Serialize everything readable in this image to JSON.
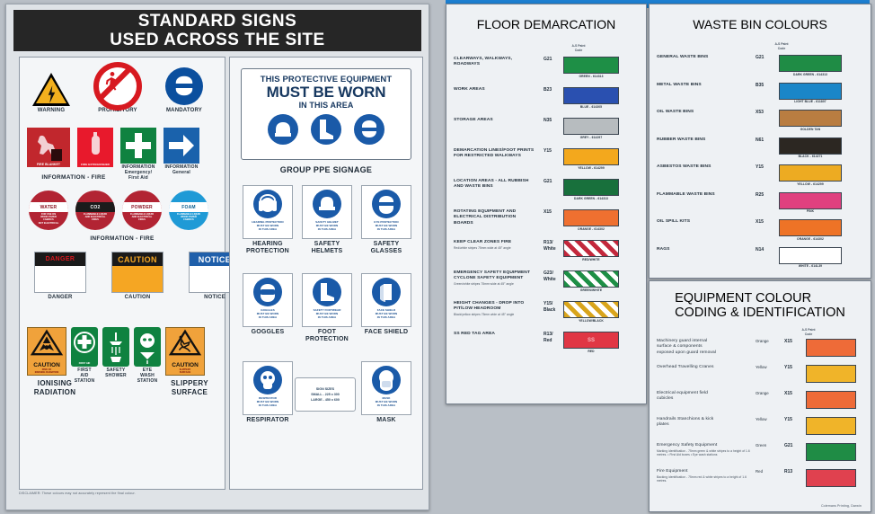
{
  "left_poster": {
    "title": "STANDARD SIGNS\nUSED ACROSS THE SITE",
    "title_line1": "STANDARD SIGNS",
    "title_line2": "USED ACROSS THE SITE",
    "disclaimer": "DISCLAIMER: These colours may not accurately represent the final colour.",
    "sign_types": [
      {
        "label": "WARNING",
        "icon": "warning-triangle-icon",
        "color": "#f2b01e"
      },
      {
        "label": "PROHIBITORY",
        "icon": "prohibition-circle-icon",
        "color": "#d71920"
      },
      {
        "label": "MANDATORY",
        "icon": "mandatory-circle-icon",
        "color": "#0b4f9e"
      }
    ],
    "information_fire": {
      "group_label": "INFORMATION - FIRE",
      "items": [
        {
          "label": "FIRE BLANKET",
          "caption": "",
          "color": "#c1272d",
          "icon": "fire-blanket-icon"
        },
        {
          "label": "FIRE EXTINGUISHER",
          "caption": "",
          "color": "#e8192c",
          "icon": "fire-extinguisher-icon"
        },
        {
          "label": "",
          "caption": "INFORMATION\nEmergency/\nFirst Aid",
          "color": "#0f8240",
          "icon": "first-aid-cross-icon"
        },
        {
          "label": "",
          "caption": "INFORMATION\nGeneral",
          "color": "#1a62ac",
          "icon": "arrow-right-icon"
        }
      ]
    },
    "extinguisher_types": {
      "group_label": "INFORMATION - FIRE",
      "items": [
        {
          "label": "WATER",
          "color": "#b22433",
          "text_color": "#8c1322",
          "sub": "FOR USE ON\nWOOD PAPER\nFABRICS\nNOT ELECTRICAL"
        },
        {
          "label": "CO2",
          "color": "#b22433",
          "band_color": "#1b1b1b",
          "band_text_color": "#ffffff",
          "sub": "FLAMMABLE LIQUID\nAND ELECTRICAL\nFIRES"
        },
        {
          "label": "POWDER",
          "color": "#b22433",
          "text_color": "#8c1322",
          "sub": "FLAMMABLE LIQUID\nAND ELECTRICAL\nFIRES"
        },
        {
          "label": "FOAM",
          "color": "#1f9ad6",
          "text_color": "#0a5f91",
          "sub": "FLAMMABLE LIQUID\nWOOD PAPER\nFABRICS"
        }
      ]
    },
    "header_signs": [
      {
        "label": "DANGER",
        "word": "DANGER",
        "header_color": "#1a1a1a",
        "word_color": "#d71920",
        "body_color": "#ffffff"
      },
      {
        "label": "CAUTION",
        "word": "CAUTION",
        "header_color": "#1a1a1a",
        "word_color": "#f5a623",
        "body_color": "#f5a623"
      },
      {
        "label": "NOTICE",
        "word": "NOTICE",
        "header_color": "#1f5faa",
        "word_color": "#ffffff",
        "body_color": "#ffffff"
      }
    ],
    "bottom_signs": [
      {
        "caption": "IONISING\nRADIATION",
        "sign_word": "CAUTION",
        "sign_sub": "RISK OF\nIONISING RADIATION",
        "color": "#f0a23b",
        "icon": "radiation-trefoil-icon"
      },
      {
        "caption": "FIRST\nAID\nSTATION",
        "sign_word": "FIRST AID",
        "color": "#0f8240",
        "icon": "first-aid-cross-icon"
      },
      {
        "caption": "SAFETY\nSHOWER",
        "sign_word": "",
        "color": "#0f8240",
        "icon": "safety-shower-icon"
      },
      {
        "caption": "EYE\nWASH\nSTATION",
        "sign_word": "",
        "color": "#0f8240",
        "icon": "eye-wash-icon"
      },
      {
        "caption": "SLIPPERY\nSURFACE",
        "sign_word": "CAUTION",
        "sign_sub": "SLIPPERY\nSURFACE",
        "color": "#f0a23b",
        "icon": "slip-hazard-icon"
      }
    ],
    "group_ppe": {
      "line1": "THIS PROTECTIVE EQUIPMENT",
      "line2": "MUST BE WORN",
      "line3": "IN THIS AREA",
      "caption": "GROUP PPE SIGNAGE",
      "icons": [
        "hard-hat-icon",
        "safety-boot-icon",
        "safety-glasses-icon"
      ]
    },
    "ppe_signs": [
      {
        "caption": "HEARING\nPROTECTION",
        "sign_text": "HEARING PROTECTION\nMUST BE WORN\nIN THIS AREA",
        "icon": "ear-muffs-icon"
      },
      {
        "caption": "SAFETY\nHELMETS",
        "sign_text": "SAFETY HELMET\nMUST BE WORN\nIN THIS AREA",
        "icon": "hard-hat-icon"
      },
      {
        "caption": "SAFETY\nGLASSES",
        "sign_text": "EYE PROTECTION\nMUST BE WORN\nIN THIS AREA",
        "icon": "safety-glasses-icon"
      },
      {
        "caption": "GOGGLES",
        "sign_text": "GOGGLES\nMUST BE WORN\nIN THIS AREA",
        "icon": "goggles-icon"
      },
      {
        "caption": "FOOT\nPROTECTION",
        "sign_text": "SAFETY FOOTWEAR\nMUST BE WORN\nIN THIS AREA",
        "icon": "safety-boot-icon"
      },
      {
        "caption": "FACE SHIELD",
        "sign_text": "FACE SHIELD\nMUST BE WORN\nIN THIS AREA",
        "icon": "face-shield-icon"
      },
      {
        "caption": "RESPIRATOR",
        "sign_text": "RESPIRATOR\nMUST BE WORN\nIN THIS AREA",
        "icon": "respirator-icon"
      },
      {
        "caption": "MASK",
        "sign_text": "MASK\nMUST BE WORN\nIN THIS AREA",
        "icon": "dust-mask-icon"
      }
    ],
    "sizes_note": {
      "line1": "SIGN SIZES",
      "line2": "SMALL - 225 x 300",
      "line3": "LARGE - 450 x 600"
    }
  },
  "floor_demarcation": {
    "title": "FLOOR DEMARCATION",
    "code_header": "A-S Paint\nCode",
    "rows": [
      {
        "name": "CLEARWAYS, WALKWAYS,\nROADWAYS",
        "sub": "",
        "code": "G21",
        "swatch": "#1e8f46",
        "swatch_label": "GREEN - 614313",
        "pattern": "solid"
      },
      {
        "name": "WORK AREAS",
        "sub": "",
        "code": "B23",
        "swatch": "#2a50b0",
        "swatch_label": "BLUE - 614305",
        "pattern": "solid"
      },
      {
        "name": "STORAGE AREAS",
        "sub": "",
        "code": "N35",
        "swatch": "#b7bcbf",
        "swatch_label": "GREY - 614297",
        "pattern": "solid"
      },
      {
        "name": "DEMARCATION LINES/FOOT PRINTS\nFOR RESTRICTED WALKWAYS",
        "sub": "",
        "code": "Y15",
        "swatch": "#f3a81d",
        "swatch_label": "YELLOW - 614299",
        "pattern": "solid"
      },
      {
        "name": "LOCATION AREAS - ALL RUBBISH\nAND WASTE BINS",
        "sub": "",
        "code": "G21",
        "swatch": "#18703c",
        "swatch_label": "DARK GREEN - 614313",
        "pattern": "solid"
      },
      {
        "name": "ROTATING EQUIPMENT AND\nELECTRICAL DISTRIBUTION\nBOARDS",
        "sub": "",
        "code": "X15",
        "swatch": "#ef7030",
        "swatch_label": "ORANGE - 614302",
        "pattern": "solid"
      },
      {
        "name": "KEEP CLEAR ZONES FIRE",
        "sub": "Red/white stripes 75mm wide at 45° angle",
        "code": "R13/\nWhite",
        "swatch": "#c3283c",
        "swatch_label": "RED/WHITE",
        "pattern": "stripe"
      },
      {
        "name": "EMERGENCY SAFETY EQUIPMENT\nCYCLONE SAFETY EQUIPMENT",
        "sub": "Green/white stripes 75mm wide at 45° angle",
        "code": "G23/\nWhite",
        "swatch": "#1e8f46",
        "swatch_label": "GREEN/WHITE",
        "pattern": "stripe"
      },
      {
        "name": "HEIGHT CHANGES - DROP INTO\nPIT/LOW HEADROOM",
        "sub": "Black/yellow stripes 75mm wide at 45° angle",
        "code": "Y15/\nBlack",
        "swatch": "#d9a51c",
        "swatch_label": "YELLOW/BLACK",
        "pattern": "stripe"
      },
      {
        "name": "SS RED TAG AREA",
        "sub": "",
        "code": "R13/\nRed",
        "swatch": "#e03644",
        "swatch_label": "RED",
        "pattern": "solid_text",
        "swatch_text": "SS"
      }
    ]
  },
  "waste_bins": {
    "title": "WASTE BIN COLOURS",
    "code_header": "A-S Paint\nCode",
    "rows": [
      {
        "name": "GENERAL WASTE BINS",
        "code": "G21",
        "swatch": "#1f8c45",
        "swatch_label": "DARK GREEN - 614313"
      },
      {
        "name": "METAL WASTE BINS",
        "code": "B35",
        "swatch": "#1a86c8",
        "swatch_label": "LIGHT BLUE - 611807"
      },
      {
        "name": "OIL WASTE BINS",
        "code": "X53",
        "swatch": "#b97d41",
        "swatch_label": "GOLDEN TAN"
      },
      {
        "name": "RUBBER WASTE BINS",
        "code": "N61",
        "swatch": "#2c2722",
        "swatch_label": "BLACK - 614271"
      },
      {
        "name": "ASBESTOS WASTE BINS",
        "code": "Y15",
        "swatch": "#edab22",
        "swatch_label": "YELLOW - 614299"
      },
      {
        "name": "FLAMMABLE WASTE BINS",
        "code": "R25",
        "swatch": "#e0407f",
        "swatch_label": "PINK"
      },
      {
        "name": "OIL SPILL KITS",
        "code": "X15",
        "swatch": "#ee7326",
        "swatch_label": "ORANGE - 614302"
      },
      {
        "name": "RAGS",
        "code": "N14",
        "swatch": "#ffffff",
        "swatch_label": "WHITE - 614L39"
      }
    ]
  },
  "equipment_coding": {
    "title_line1": "EQUIPMENT COLOUR",
    "title_line2": "CODING & IDENTIFICATION",
    "code_header": "A-S Paint\nCode",
    "rows": [
      {
        "name": "Machinery guard internal\nsurface & components\nexposed upon guard removal",
        "sub": "",
        "word": "Orange",
        "code": "X15",
        "swatch": "#ee6b38"
      },
      {
        "name": "Overhead Travelling Cranes",
        "sub": "",
        "word": "Yellow",
        "code": "Y15",
        "swatch": "#f0b429"
      },
      {
        "name": "Electrical equipment field\ncubicles",
        "sub": "",
        "word": "Orange",
        "code": "X15",
        "swatch": "#ee6b38"
      },
      {
        "name": "Handrails Stanchions & kick\nplates",
        "sub": "",
        "word": "Yellow",
        "code": "Y15",
        "swatch": "#f0b429"
      },
      {
        "name": "Emergency Safety Equipment",
        "sub": "Marking identification - 75mm green & white stripes to a height of 1.6\nmetres. • First Aid boxes • Eye wash stations",
        "word": "Green",
        "code": "G21",
        "swatch": "#1f8c45"
      },
      {
        "name": "Fire Equipment",
        "sub": "Backing identification - 75mm red & white stripes to a height of 1.6\nmetres.",
        "word": "Red",
        "code": "R13",
        "swatch": "#e0414f"
      }
    ],
    "credit": "Colemans Printing, Darwin"
  }
}
